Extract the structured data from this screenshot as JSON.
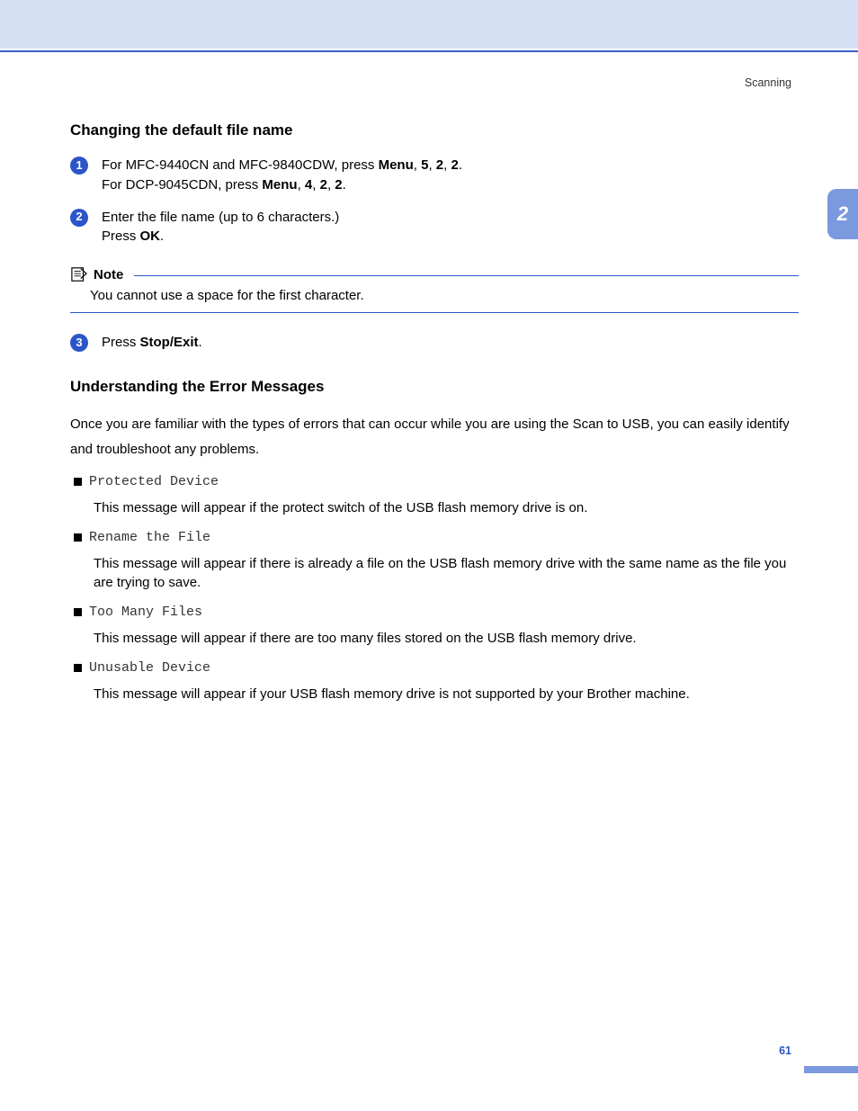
{
  "header": {
    "section": "Scanning"
  },
  "chapter_tab": "2",
  "section1": {
    "title": "Changing the default file name",
    "step1_a_pre": "For MFC-9440CN and MFC-9840CDW, press ",
    "step1_a_menu": "Menu",
    "step1_a_k1": "5",
    "step1_a_k2": "2",
    "step1_a_k3": "2",
    "step1_b_pre": "For DCP-9045CDN, press ",
    "step1_b_menu": "Menu",
    "step1_b_k1": "4",
    "step1_b_k2": "2",
    "step1_b_k3": "2",
    "step2_line1": "Enter the file name (up to 6 characters.)",
    "step2_line2_pre": "Press ",
    "step2_line2_key": "OK",
    "note_label": "Note",
    "note_body": "You cannot use a space for the first character.",
    "step3_pre": "Press ",
    "step3_key": "Stop/Exit"
  },
  "section2": {
    "title": "Understanding the Error Messages",
    "intro": "Once you are familiar with the types of errors that can occur while you are using the Scan to USB, you can easily identify and troubleshoot any problems.",
    "errors": [
      {
        "code": "Protected Device",
        "desc": "This message will appear if the protect switch of the USB flash memory drive is on."
      },
      {
        "code": "Rename the File",
        "desc": "This message will appear if there is already a file on the USB flash memory drive with the same name as the file you are trying to save."
      },
      {
        "code": "Too Many Files",
        "desc": "This message will appear if there are too many files stored on the USB flash memory drive."
      },
      {
        "code": "Unusable Device",
        "desc": "This message will appear if your USB flash memory drive is not supported by your Brother machine."
      }
    ]
  },
  "page_number": "61"
}
